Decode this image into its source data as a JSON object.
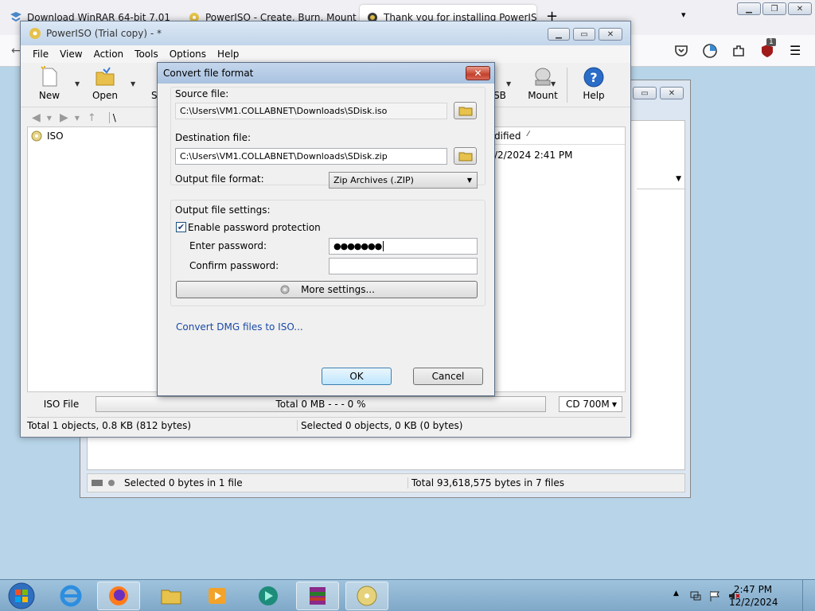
{
  "browser": {
    "tabs": [
      {
        "title": "Download WinRAR 64-bit 7.01 ("
      },
      {
        "title": "PowerISO - Create, Burn, Mount"
      },
      {
        "title": "Thank you for installing PowerIS"
      }
    ],
    "new_tab_symbol": "+",
    "badge_count": "1"
  },
  "back_window": {
    "status_left": "Selected 0 bytes in 1 file",
    "status_right": "Total 93,618,575 bytes in 7 files"
  },
  "poweriso": {
    "title": "PowerISO (Trial copy) - *",
    "menu": [
      "File",
      "View",
      "Action",
      "Tools",
      "Options",
      "Help"
    ],
    "toolbar": {
      "new": "New",
      "open": "Open",
      "save_partial": "S",
      "usb_partial": "SB",
      "mount": "Mount",
      "help": "Help"
    },
    "address_path": "\\",
    "tree_root": "ISO",
    "column_modified": "dified",
    "file_modified": "/2/2024 2:41 PM",
    "capacity": {
      "type": "ISO File",
      "total_text": "Total  0 MB   - - -  0 %",
      "media": "CD 700M"
    },
    "status_left": "Total 1 objects, 0.8 KB (812 bytes)",
    "status_right": "Selected 0 objects, 0 KB (0 bytes)"
  },
  "dialog": {
    "title": "Convert file format",
    "source_label": "Source file:",
    "source_value": "C:\\Users\\VM1.COLLABNET\\Downloads\\SDisk.iso",
    "dest_label": "Destination file:",
    "dest_value": "C:\\Users\\VM1.COLLABNET\\Downloads\\SDisk.zip",
    "format_label": "Output file format:",
    "format_value": "Zip Archives (.ZIP)",
    "settings_label": "Output file settings:",
    "enable_password_label": "Enable password protection",
    "enable_password_checked": true,
    "enter_password_label": "Enter password:",
    "enter_password_value": "●●●●●●●",
    "confirm_password_label": "Confirm password:",
    "confirm_password_value": "",
    "more_settings": "More settings...",
    "dmg_link": "Convert DMG files to ISO...",
    "ok": "OK",
    "cancel": "Cancel"
  },
  "taskbar": {
    "time": "2:47 PM",
    "date": "12/2/2024"
  },
  "colors": {
    "accent": "#3c7fb1",
    "link": "#1a49a6",
    "close_red": "#c4412c"
  }
}
